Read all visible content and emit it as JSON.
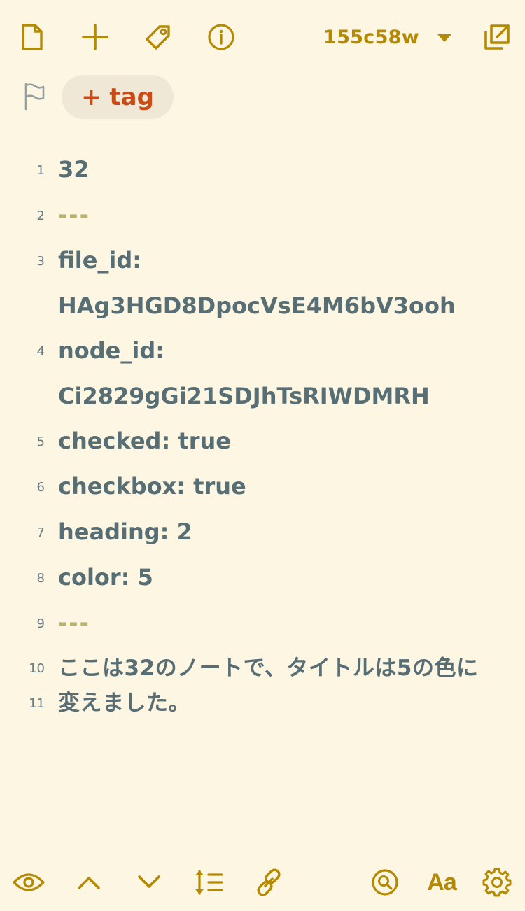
{
  "top_toolbar": {
    "icons": {
      "new_file": "file-icon",
      "add": "plus-icon",
      "tags": "tag-icon",
      "info": "info-icon",
      "expand": "expand-icon"
    },
    "commit_selector": {
      "label": "155c58w"
    }
  },
  "tag_row": {
    "flag_icon": "flag-icon",
    "add_tag_label": "+ tag"
  },
  "editor": {
    "lines": [
      {
        "number": "1",
        "rows": [
          "32"
        ]
      },
      {
        "number": "2",
        "rows": [
          "---"
        ]
      },
      {
        "number": "3",
        "rows": [
          "file_id:",
          "HAg3HGD8DpocVsE4M6bV3ooh"
        ]
      },
      {
        "number": "4",
        "rows": [
          "node_id:",
          "Ci2829gGi21SDJhTsRIWDMRH"
        ]
      },
      {
        "number": "5",
        "rows": [
          "checked: true"
        ]
      },
      {
        "number": "6",
        "rows": [
          "checkbox: true"
        ]
      },
      {
        "number": "7",
        "rows": [
          "heading: 2"
        ]
      },
      {
        "number": "8",
        "rows": [
          "color: 5"
        ]
      },
      {
        "number": "9",
        "rows": [
          "---"
        ]
      },
      {
        "number": "10",
        "rows": [
          "ここは32のノートで、タイトルは5の色に"
        ]
      },
      {
        "number": "11",
        "rows": [
          "変えました。"
        ]
      }
    ]
  },
  "bottom_toolbar": {
    "icons": [
      "eye-icon",
      "chevron-up-icon",
      "chevron-down-icon",
      "line-height-icon",
      "link-icon",
      "search-icon",
      "font-size-icon",
      "gear-icon"
    ],
    "font_label": "Aa"
  },
  "colors": {
    "background": "#fdf6e3",
    "accent": "#b58900",
    "tag_text": "#cb4b16",
    "tag_bg": "#f0e8d6",
    "body_text": "#586e75",
    "frontmatter_dash": "#b9b36d"
  }
}
